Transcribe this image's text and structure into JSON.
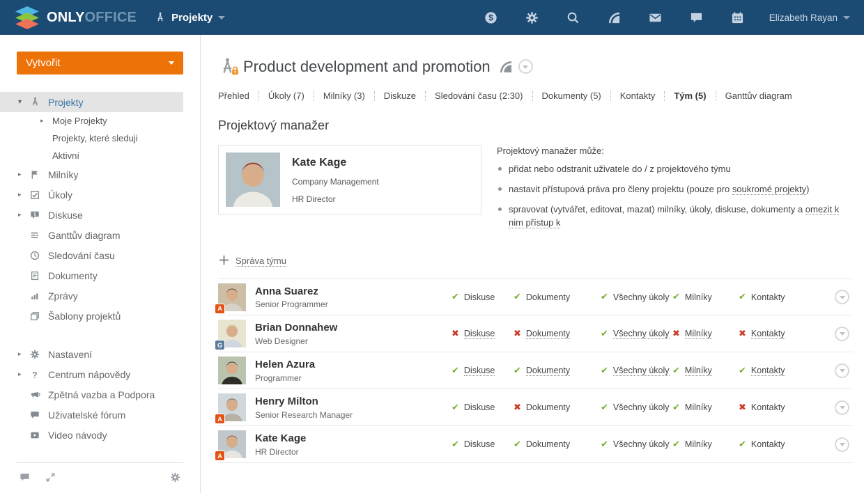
{
  "navbar": {
    "logo_only": "ONLY",
    "logo_office": "OFFICE",
    "product_menu": "Projekty",
    "icons": [
      "payments",
      "settings",
      "search",
      "feed",
      "mail",
      "talk",
      "calendar"
    ],
    "user": "Elizabeth Rayan"
  },
  "sidebar": {
    "create_button": "Vytvořit",
    "items": [
      {
        "label": "Projekty",
        "icon": "compass",
        "caret": "expanded",
        "selected": true
      },
      {
        "label": "Moje Projekty",
        "sub": true,
        "caret": "collapsed"
      },
      {
        "label": "Projekty, které sleduji",
        "sub": true
      },
      {
        "label": "Aktivní",
        "sub": true
      },
      {
        "label": "Milníky",
        "icon": "flag",
        "caret": "collapsed"
      },
      {
        "label": "Úkoly",
        "icon": "task",
        "caret": "collapsed"
      },
      {
        "label": "Diskuse",
        "icon": "discussion",
        "caret": "collapsed"
      },
      {
        "label": "Ganttův diagram",
        "icon": "gantt"
      },
      {
        "label": "Sledování času",
        "icon": "clock"
      },
      {
        "label": "Dokumenty",
        "icon": "document"
      },
      {
        "label": "Zprávy",
        "icon": "reports"
      },
      {
        "label": "Šablony projektů",
        "icon": "template"
      },
      {
        "label": "Nastavení",
        "icon": "gear",
        "caret": "collapsed",
        "group2": true
      },
      {
        "label": "Centrum nápovědy",
        "icon": "question",
        "caret": "collapsed",
        "group2": false
      },
      {
        "label": "Zpětná vazba a Podpora",
        "icon": "megaphone"
      },
      {
        "label": "Uživatelské fórum",
        "icon": "forum"
      },
      {
        "label": "Video návody",
        "icon": "video"
      }
    ]
  },
  "page": {
    "title": "Product development and promotion",
    "tabs": [
      {
        "label": "Přehled",
        "active": false
      },
      {
        "label": "Úkoly (7)",
        "active": false
      },
      {
        "label": "Milníky (3)",
        "active": false
      },
      {
        "label": "Diskuze",
        "active": false
      },
      {
        "label": "Sledování času (2:30)",
        "active": false
      },
      {
        "label": "Dokumenty (5)",
        "active": false
      },
      {
        "label": "Kontakty",
        "active": false
      },
      {
        "label": "Tým (5)",
        "active": true
      },
      {
        "label": "Ganttův diagram",
        "active": false
      }
    ],
    "section_title": "Projektový manažer",
    "manager": {
      "name": "Kate Kage",
      "company": "Company Management",
      "role": "HR Director",
      "photo_colors": {
        "bg": "#b6c3c9",
        "hair": "#a63d1d",
        "shirt": "#eceae4"
      }
    },
    "rights": {
      "title": "Projektový manažer může:",
      "items": [
        {
          "text": "přidat nebo odstranit uživatele do / z projektového týmu",
          "link": "",
          "suffix": ""
        },
        {
          "text": "nastavit přístupová práva pro členy projektu (pouze pro ",
          "link": "soukromé projekty",
          "suffix": ")"
        },
        {
          "text": "spravovat (vytvářet, editovat, mazat) milníky, úkoly, diskuse, dokumenty a ",
          "link": "omezit k nim přístup k",
          "suffix": ""
        }
      ]
    },
    "manage_team_link": "Správa týmu",
    "team": [
      {
        "name": "Anna Suarez",
        "role": "Senior Programmer",
        "badge": "A",
        "badge_color": "#e25314",
        "underlined": false,
        "avatar": {
          "bg": "#cdbfa6",
          "hair": "#5a3d28",
          "shirt": "#d8d3c8"
        },
        "perms": [
          {
            "label": "Diskuse",
            "allowed": true
          },
          {
            "label": "Dokumenty",
            "allowed": true
          },
          {
            "label": "Všechny úkoly",
            "allowed": true
          },
          {
            "label": "Milníky",
            "allowed": true
          },
          {
            "label": "Kontakty",
            "allowed": true
          }
        ]
      },
      {
        "name": "Brian Donnahew",
        "role": "Web Designer",
        "badge": "G",
        "badge_color": "#5a7a9e",
        "underlined": true,
        "avatar": {
          "bg": "#e8e4d2",
          "hair": "#d9c178",
          "shirt": "#cfd6dd"
        },
        "perms": [
          {
            "label": "Diskuse",
            "allowed": false
          },
          {
            "label": "Dokumenty",
            "allowed": false
          },
          {
            "label": "Všechny úkoly",
            "allowed": true
          },
          {
            "label": "Milníky",
            "allowed": false
          },
          {
            "label": "Kontakty",
            "allowed": false
          }
        ]
      },
      {
        "name": "Helen Azura",
        "role": "Programmer",
        "badge": "",
        "badge_color": "",
        "underlined": true,
        "avatar": {
          "bg": "#b9c3ad",
          "hair": "#3a3430",
          "shirt": "#2f2d2a"
        },
        "perms": [
          {
            "label": "Diskuse",
            "allowed": true
          },
          {
            "label": "Dokumenty",
            "allowed": true
          },
          {
            "label": "Všechny úkoly",
            "allowed": true
          },
          {
            "label": "Milníky",
            "allowed": true
          },
          {
            "label": "Kontakty",
            "allowed": true
          }
        ]
      },
      {
        "name": "Henry Milton",
        "role": "Senior Research Manager",
        "badge": "A",
        "badge_color": "#e25314",
        "underlined": false,
        "avatar": {
          "bg": "#cfd8db",
          "hair": "#7a5b3e",
          "shirt": "#b8b2a6"
        },
        "perms": [
          {
            "label": "Diskuse",
            "allowed": true
          },
          {
            "label": "Dokumenty",
            "allowed": false
          },
          {
            "label": "Všechny úkoly",
            "allowed": true
          },
          {
            "label": "Milníky",
            "allowed": true
          },
          {
            "label": "Kontakty",
            "allowed": false
          }
        ]
      },
      {
        "name": "Kate Kage",
        "role": "HR Director",
        "badge": "A",
        "badge_color": "#e25314",
        "underlined": false,
        "avatar": {
          "bg": "#bfc9cd",
          "hair": "#a83c1c",
          "shirt": "#e8e6e0"
        },
        "perms": [
          {
            "label": "Diskuse",
            "allowed": true
          },
          {
            "label": "Dokumenty",
            "allowed": true
          },
          {
            "label": "Všechny úkoly",
            "allowed": true
          },
          {
            "label": "Milníky",
            "allowed": true
          },
          {
            "label": "Kontakty",
            "allowed": true
          }
        ]
      }
    ]
  },
  "colors": {
    "navbar": "#1b4a73",
    "accent_orange": "#ed7309",
    "allowed_green": "#7bae37",
    "denied_red": "#cc3a27",
    "selected_item_bg": "#e4e4e4",
    "link_blue": "#3a77a9",
    "lock_orange": "#f49123"
  },
  "marks": {
    "allowed": "✔",
    "denied": "✖"
  }
}
